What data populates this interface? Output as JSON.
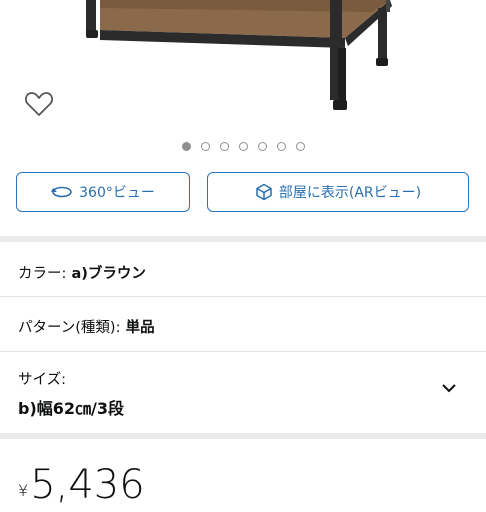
{
  "buttons": {
    "view360_label": "360°ビュー",
    "ar_view_label": "部屋に表示(ARビュー)"
  },
  "carousel": {
    "total": 7,
    "active_index": 0
  },
  "options": {
    "color": {
      "label": "カラー:",
      "value": "a)ブラウン"
    },
    "pattern": {
      "label": "パターン(種類):",
      "value": "単品"
    },
    "size": {
      "label": "サイズ:",
      "value": "b)幅62㎝/3段"
    }
  },
  "price": {
    "symbol": "¥",
    "amount": "5,436"
  },
  "colors": {
    "accent": "#2a73b8",
    "wood": "#8a6a4a",
    "frame": "#2b2b2b"
  }
}
